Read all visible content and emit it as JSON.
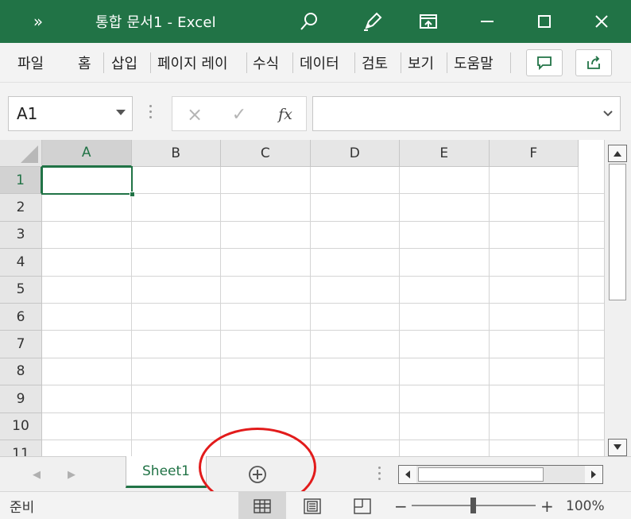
{
  "titlebar": {
    "overflow_label": "»",
    "title": "통합 문서1  -  Excel",
    "icons": [
      "search-icon",
      "pen-icon",
      "ribbon-display-icon",
      "minimize-icon",
      "maximize-icon",
      "close-icon"
    ]
  },
  "ribbon": {
    "tabs": [
      {
        "label": "파일"
      },
      {
        "label": "홈"
      },
      {
        "label": "삽입"
      },
      {
        "label": "페이지 레이"
      },
      {
        "label": "수식"
      },
      {
        "label": "데이터"
      },
      {
        "label": "검토"
      },
      {
        "label": "보기"
      },
      {
        "label": "도움말"
      }
    ],
    "buttons": [
      "comment-icon",
      "share-icon"
    ]
  },
  "formula_bar": {
    "name_box": "A1",
    "cancel_icon": "×",
    "enter_icon": "✓",
    "fx_label": "fx",
    "value": ""
  },
  "grid": {
    "columns": [
      "A",
      "B",
      "C",
      "D",
      "E",
      "F"
    ],
    "rows": [
      "1",
      "2",
      "3",
      "4",
      "5",
      "6",
      "7",
      "8",
      "9",
      "10",
      "11"
    ],
    "active_cell": "A1"
  },
  "sheets": {
    "tabs": [
      {
        "label": "Sheet1",
        "active": true
      }
    ],
    "add_label": "+"
  },
  "status": {
    "text": "준비",
    "zoom_minus": "−",
    "zoom_plus": "+",
    "zoom": "100%",
    "zoom_level_percent": 100
  },
  "colors": {
    "accent": "#217346",
    "annotation_circle": "#e21b1b"
  }
}
